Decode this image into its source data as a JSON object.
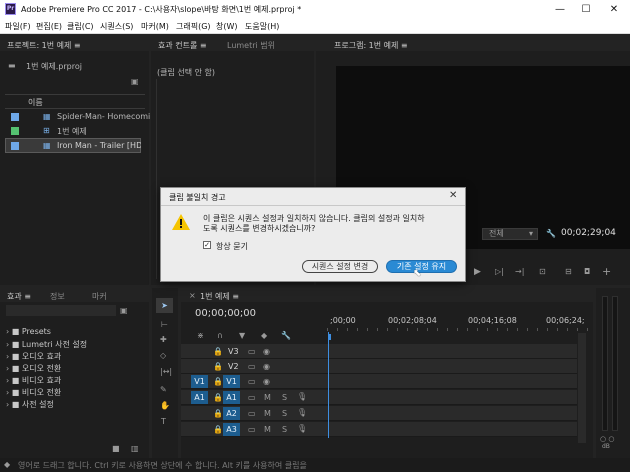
{
  "window": {
    "title": "Adobe Premiere Pro CC 2017 - C:\\사용자\\slope\\바탕 화면\\1번 예제.prproj *",
    "logo": "Pr",
    "minimize": "—",
    "maximize": "☐",
    "close": "✕"
  },
  "menu": [
    "파일(F)",
    "편집(E)",
    "클립(C)",
    "시퀀스(S)",
    "마커(M)",
    "그래픽(G)",
    "창(W)",
    "도움말(H)"
  ],
  "project": {
    "tab": "프로젝트: 1번 예제 ≡",
    "file": "1번 예제.prproj",
    "col_name": "이름",
    "items": [
      {
        "name": "Spider-Man- Homecomi",
        "color": "#6ea8e8"
      },
      {
        "name": "1번 예제",
        "color": "#55c271"
      },
      {
        "name": "Iron Man - Trailer [HD].m",
        "color": "#6ea8e8"
      }
    ]
  },
  "effect_controls": {
    "tab": "효과 컨트롤 ≡",
    "tab2": "Lumetri 범위",
    "no_clip": "(클립 선택 안 함)"
  },
  "program": {
    "tab": "프로그램: 1번 예제 ≡",
    "fit": "전체",
    "timecode": "00;02;29;04"
  },
  "dialog": {
    "title": "클립 불일치 경고",
    "close": "✕",
    "message_line1": "이 클립은 시퀀스 설정과 일치하지 않습니다. 클립의 설정과 일치하",
    "message_line2": "도록 시퀀스를 변경하시겠습니까?",
    "always_ask": "항상 묻기",
    "change_button": "시퀀스 설정 변경",
    "keep_button": "기존 설정 유지"
  },
  "effects": {
    "tabs": [
      "효과 ≡",
      "정보",
      "마커"
    ],
    "items": [
      "Presets",
      "Lumetri 사전 설정",
      "오디오 효과",
      "오디오 전환",
      "비디오 효과",
      "비디오 전환",
      "사전 설정"
    ]
  },
  "timeline": {
    "tab": "1번 예제 ≡",
    "timecode": "00;00;00;00",
    "ruler": [
      ";00;00",
      "00;02;08;04",
      "00;04;16;08",
      "00;06;24;"
    ],
    "tracks": [
      {
        "src": "",
        "name": "V3"
      },
      {
        "src": "",
        "name": "V2"
      },
      {
        "src": "V1",
        "name": "V1"
      },
      {
        "src": "A1",
        "name": "A1"
      },
      {
        "src": "",
        "name": "A2"
      },
      {
        "src": "",
        "name": "A3"
      }
    ],
    "audio_meter": "dB"
  },
  "status": "영어로 드래그 합니다. Ctrl 키로 사용하면 상단에 수 합니다. Alt 키를 사용하여 클립을",
  "colors": {
    "accent": "#1d5d8f",
    "button_blue": "#2a8ad4",
    "warning": "#f5c400"
  }
}
